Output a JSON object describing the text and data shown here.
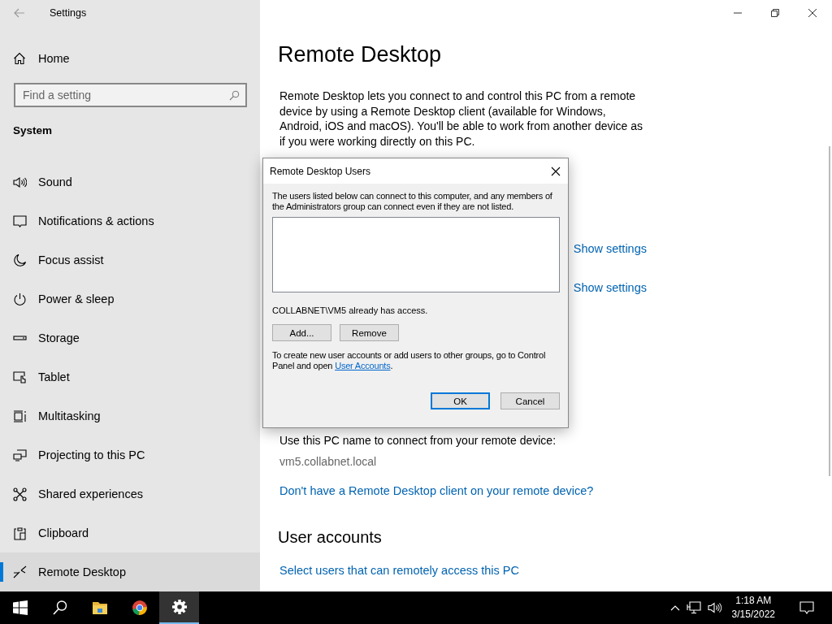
{
  "window": {
    "title": "Settings"
  },
  "sidebar": {
    "home": "Home",
    "search": {
      "placeholder": "Find a setting"
    },
    "section": "System",
    "items": [
      {
        "kind": "sound",
        "label": "Sound",
        "selected": false
      },
      {
        "kind": "notifications",
        "label": "Notifications & actions",
        "selected": false
      },
      {
        "kind": "focus",
        "label": "Focus assist",
        "selected": false
      },
      {
        "kind": "power",
        "label": "Power & sleep",
        "selected": false
      },
      {
        "kind": "storage",
        "label": "Storage",
        "selected": false
      },
      {
        "kind": "tablet",
        "label": "Tablet",
        "selected": false
      },
      {
        "kind": "multitasking",
        "label": "Multitasking",
        "selected": false
      },
      {
        "kind": "projecting",
        "label": "Projecting to this PC",
        "selected": false
      },
      {
        "kind": "shared",
        "label": "Shared experiences",
        "selected": false
      },
      {
        "kind": "clipboard",
        "label": "Clipboard",
        "selected": false
      },
      {
        "kind": "remote",
        "label": "Remote Desktop",
        "selected": true
      }
    ]
  },
  "page": {
    "title": "Remote Desktop",
    "description": "Remote Desktop lets you connect to and control this PC from a remote device by using a Remote Desktop client (available for Windows, Android, iOS and macOS). You'll be able to work from another device as if you were working directly on this PC.",
    "settings_links": [
      "Show settings",
      "Show settings"
    ],
    "pc_name_label": "Use this PC name to connect from your remote device:",
    "pc_name": "vm5.collabnet.local",
    "client_link": "Don't have a Remote Desktop client on your remote device?",
    "user_accounts": {
      "heading": "User accounts",
      "link": "Select users that can remotely access this PC"
    }
  },
  "dialog": {
    "title": "Remote Desktop Users",
    "description": "The users listed below can connect to this computer, and any members of the Administrators group can connect even if they are not listed.",
    "access_note": "COLLABNET\\VM5 already has access.",
    "buttons": [
      "Add...",
      "Remove"
    ],
    "footer_text": "To create new user accounts or add users to other groups, go to Control Panel and open ",
    "footer_link": "User Accounts",
    "footer_end": ".",
    "actions": [
      {
        "label": "OK",
        "default": true
      },
      {
        "label": "Cancel",
        "default": false
      }
    ]
  },
  "taskbar": {
    "apps": [
      {
        "kind": "start",
        "active": false
      },
      {
        "kind": "search",
        "active": false
      },
      {
        "kind": "files",
        "active": false
      },
      {
        "kind": "browser",
        "active": false
      },
      {
        "kind": "settings",
        "active": true
      }
    ],
    "time": "1:18 AM",
    "date": "3/15/2022"
  }
}
